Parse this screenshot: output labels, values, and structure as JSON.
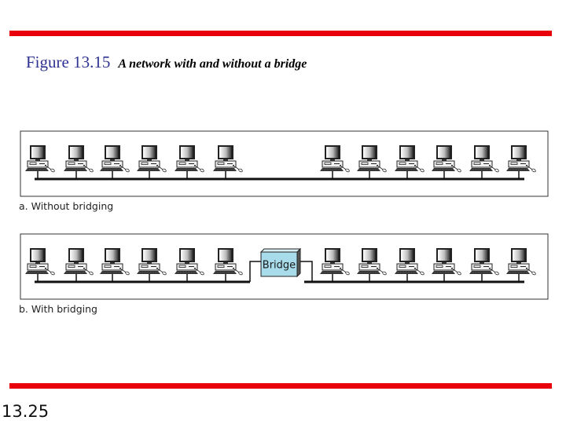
{
  "header": {
    "figure_number": "Figure 13.15",
    "caption": "A network with and without a bridge"
  },
  "colors": {
    "accent_red": "#e8000b",
    "figure_number_blue": "#2e3192",
    "bridge_fill": "#a8dcea"
  },
  "panels": [
    {
      "id": "a",
      "label": "a. Without bridging",
      "segments": [
        {
          "computers": 6
        },
        {
          "computers": 6
        }
      ],
      "bridged": false
    },
    {
      "id": "b",
      "label": "b. With bridging",
      "segments": [
        {
          "computers": 6
        },
        {
          "computers": 6
        }
      ],
      "bridged": true,
      "bridge_label": "Bridge"
    }
  ],
  "footer": {
    "page_number": "13.25"
  }
}
